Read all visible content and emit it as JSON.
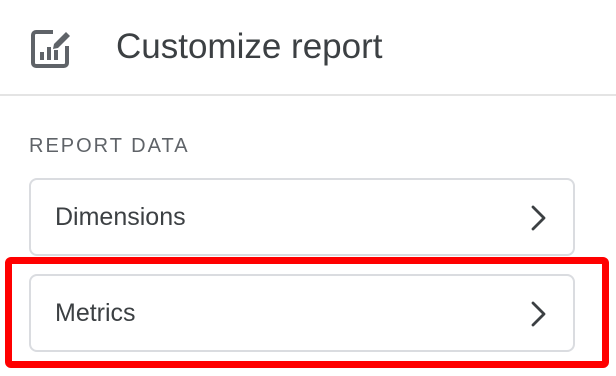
{
  "header": {
    "title": "Customize report",
    "icon": "edit-report-icon"
  },
  "report_data": {
    "section_label": "REPORT DATA",
    "items": [
      {
        "label": "Dimensions",
        "icon": "chevron-right-icon"
      },
      {
        "label": "Metrics",
        "icon": "chevron-right-icon",
        "highlighted": true
      }
    ]
  },
  "colors": {
    "text_primary": "#3c4043",
    "text_secondary": "#5f6368",
    "border": "#dadce0",
    "highlight": "#ff0000"
  }
}
